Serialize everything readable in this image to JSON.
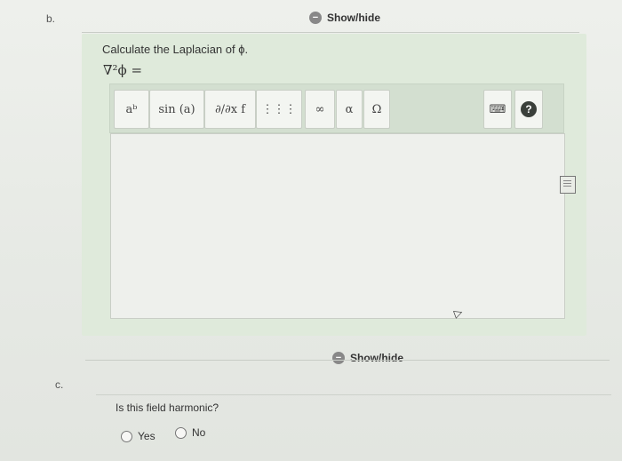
{
  "part_b": {
    "letter": "b.",
    "showhide": "Show/hide",
    "prompt": "Calculate the Laplacian of ϕ.",
    "equation": "∇²ϕ =",
    "toolbar": {
      "superscript": "aᵇ",
      "sin": "sin (a)",
      "partial": "∂/∂x f",
      "matrix": "⋮⋮⋮",
      "infinity": "∞",
      "alpha": "α",
      "omega": "Ω",
      "keyboard": "⌨",
      "help": "?"
    }
  },
  "part_c": {
    "letter": "c.",
    "showhide": "Show/hide",
    "question": "Is this field harmonic?",
    "options": [
      "Yes",
      "No"
    ]
  },
  "colors": {
    "panel": "#dfeadb",
    "toolbar": "#d3dfd0",
    "help_bg": "#3a3f3a"
  }
}
